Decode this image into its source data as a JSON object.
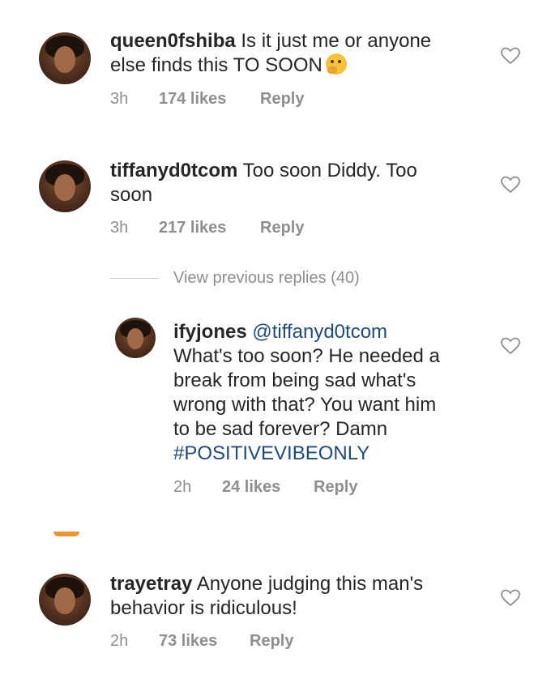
{
  "comments": [
    {
      "username": "queen0fshiba",
      "text": "Is it just me or anyone else finds this TO SOON",
      "emoji": "thinking-face-emoji",
      "time": "3h",
      "likes": "174 likes",
      "reply": "Reply"
    },
    {
      "username": "tiffanyd0tcom",
      "text": "Too soon Diddy. Too soon",
      "time": "3h",
      "likes": "217 likes",
      "reply": "Reply"
    },
    {
      "username": "trayetray",
      "text": "Anyone judging this man's behavior is ridiculous!",
      "time": "2h",
      "likes": "73 likes",
      "reply": "Reply"
    }
  ],
  "view_previous_replies": "View previous replies (40)",
  "reply_comment": {
    "username": "ifyjones",
    "mention": "@tiffanyd0tcom",
    "text": "What's too soon? He needed a break from being sad what's wrong with that? You want him to be sad forever? Damn",
    "hashtag": "#POSITIVEVIBEONLY",
    "time": "2h",
    "likes": "24 likes",
    "reply": "Reply"
  },
  "colors": {
    "text": "#262626",
    "meta": "#8e8e8e",
    "link": "#1f4a7a",
    "accent": "#f09433"
  }
}
